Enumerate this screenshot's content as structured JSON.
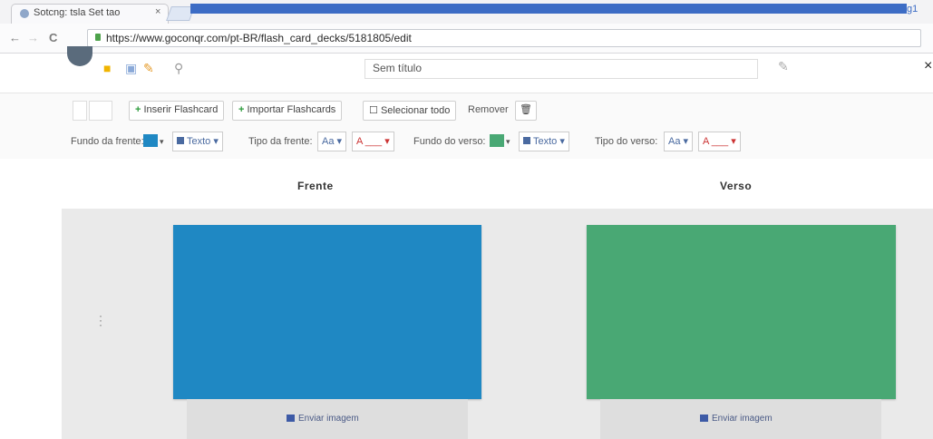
{
  "browser": {
    "tab_title": "Sotcng: tsla Set tao",
    "tab_close": "×",
    "titlebar_right": "g1",
    "url": "https://www.goconqr.com/pt-BR/flash_card_decks/5181805/edit",
    "nav_back": "←",
    "nav_forward": "→",
    "nav_reload": "C"
  },
  "app": {
    "title_value": "Sem título",
    "close": "×",
    "wand_icon": "✎"
  },
  "actions": {
    "insert_flashcard": "Inserir Flashcard",
    "import_flashcards": "Importar Flashcards",
    "select_all": "Selecionar todo",
    "delete": "Remover",
    "trash_icon": "🗑"
  },
  "styles": {
    "front_bg_label": "Fundo da frente:",
    "front_text_btn": "Texto",
    "front_type_label": "Tipo da frente:",
    "font_size": "Aa",
    "font_color": "A",
    "back_bg_label": "Fundo do verso:",
    "back_text_btn": "Texto",
    "back_type_label": "Tipo do verso:",
    "front_color": "#1f88c3",
    "back_color": "#49a874"
  },
  "columns": {
    "front": "Frente",
    "back": "Verso"
  },
  "cards": {
    "front_image_btn": "Enviar imagem",
    "back_image_btn": "Enviar imagem"
  }
}
